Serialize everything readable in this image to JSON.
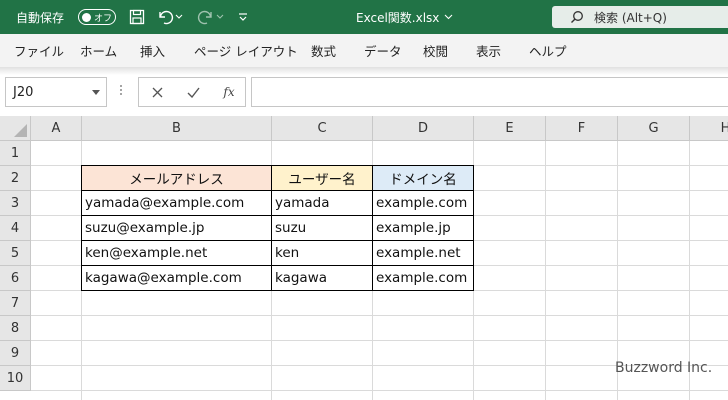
{
  "title_bar": {
    "autosave_label": "自動保存",
    "autosave_toggle": "オフ",
    "document_title": "Excel関数.xlsx",
    "search_label": "検索 (Alt+Q)",
    "accent_color": "#217346"
  },
  "ribbon": {
    "tabs": [
      "ファイル",
      "ホーム",
      "挿入",
      "ページ レイアウト",
      "数式",
      "データ",
      "校閲",
      "表示",
      "ヘルプ"
    ]
  },
  "formula_bar": {
    "name_box": "J20",
    "fx_label": "fx",
    "content": ""
  },
  "grid": {
    "columns": [
      "A",
      "B",
      "C",
      "D",
      "E",
      "F",
      "G",
      "H"
    ],
    "rows": [
      "1",
      "2",
      "3",
      "4",
      "5",
      "6",
      "7",
      "8",
      "9",
      "10"
    ],
    "table": {
      "headers": [
        "メールアドレス",
        "ユーザー名",
        "ドメイン名"
      ],
      "header_colors": [
        "#fce4d6",
        "#fff2cc",
        "#ddebf7"
      ],
      "rows": [
        [
          "yamada@example.com",
          "yamada",
          "example.com"
        ],
        [
          "suzu@example.jp",
          "suzu",
          "example.jp"
        ],
        [
          "ken@example.net",
          "ken",
          "example.net"
        ],
        [
          "kagawa@example.com",
          "kagawa",
          "example.com"
        ]
      ]
    }
  },
  "watermark": "Buzzword Inc."
}
